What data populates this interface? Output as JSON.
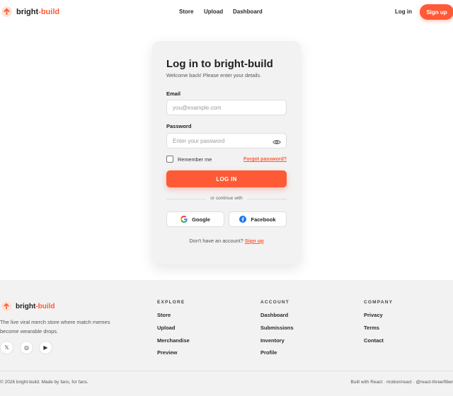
{
  "header": {
    "brand": {
      "name_main": "bright",
      "name_accent": "-build"
    },
    "nav": [
      "Store",
      "Upload",
      "Dashboard"
    ],
    "login_label": "Log in",
    "signup_label": "Sign up"
  },
  "login_card": {
    "title": "Log in to bright-build",
    "subtitle": "Welcome back! Please enter your details.",
    "email_label": "Email",
    "email_placeholder": "you@example.com",
    "email_value": "",
    "password_label": "Password",
    "password_placeholder": "Enter your password",
    "password_value": "",
    "remember_label": "Remember me",
    "remember_checked": false,
    "forgot_label": "Forgot password?",
    "submit_label": "LOG IN",
    "divider_text": "or continue with",
    "google_label": "Google",
    "facebook_label": "Facebook",
    "no_account_text": "Don't have an account?",
    "signup_link": "Sign up"
  },
  "footer": {
    "brand": {
      "name_main": "bright",
      "name_accent": "-build"
    },
    "tagline": "The live viral merch store where match memes become wearable drops.",
    "social_icons": [
      {
        "name": "x-icon",
        "glyph": "𝕏"
      },
      {
        "name": "instagram-icon",
        "glyph": "◎"
      },
      {
        "name": "youtube-icon",
        "glyph": "▶"
      }
    ],
    "columns": [
      {
        "heading": "EXPLORE",
        "links": [
          "Store",
          "Upload",
          "Merchandise",
          "Preview"
        ]
      },
      {
        "heading": "ACCOUNT",
        "links": [
          "Dashboard",
          "Submissions",
          "Inventory",
          "Profile"
        ]
      },
      {
        "heading": "COMPANY",
        "links": [
          "Privacy",
          "Terms",
          "Contact"
        ]
      }
    ],
    "copyright": "© 2026 bright-build. Made by fans, for fans.",
    "built_with": "Built with React · motion/react · @react-three/fiber"
  },
  "colors": {
    "accent": "#ff5a36",
    "surface": "#f2f2f2"
  }
}
